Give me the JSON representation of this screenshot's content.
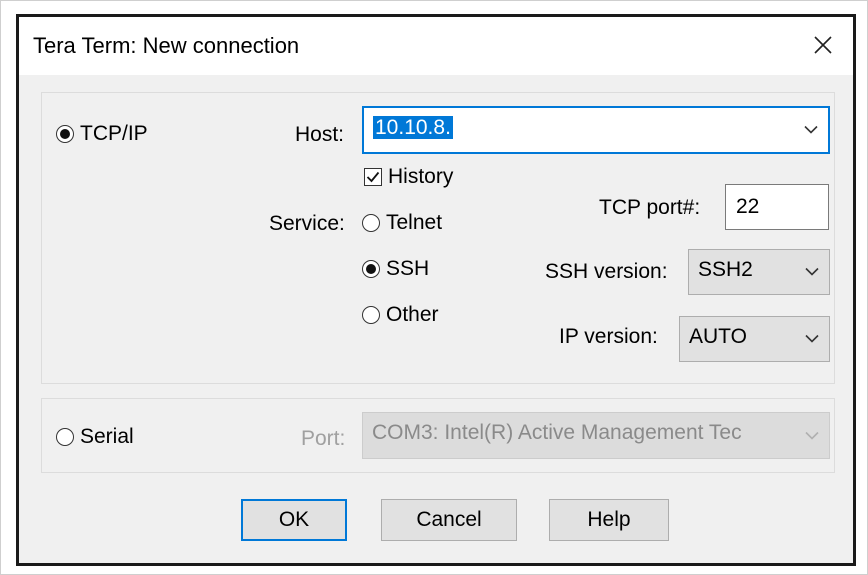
{
  "window": {
    "title": "Tera Term: New connection"
  },
  "tcpip": {
    "radio_label": "TCP/IP",
    "selected": true,
    "host_label": "Host:",
    "host_value": "10.10.8.",
    "history_label": "History",
    "history_checked": true,
    "service_label": "Service:",
    "services": [
      {
        "label": "Telnet",
        "selected": false
      },
      {
        "label": "SSH",
        "selected": true
      },
      {
        "label": "Other",
        "selected": false
      }
    ],
    "tcp_port_label": "TCP port#:",
    "tcp_port_value": "22",
    "ssh_version_label": "SSH version:",
    "ssh_version_value": "SSH2",
    "ip_version_label": "IP version:",
    "ip_version_value": "AUTO"
  },
  "serial": {
    "radio_label": "Serial",
    "selected": false,
    "port_label": "Port:",
    "port_value": "COM3: Intel(R) Active Management Tec"
  },
  "buttons": {
    "ok": "OK",
    "cancel": "Cancel",
    "help": "Help"
  },
  "icons": {
    "close": "close-icon",
    "dropdown": "chevron-down-icon",
    "check": "check-icon"
  },
  "colors": {
    "accent": "#0078d7",
    "dialog_bg": "#f0f0f0",
    "disabled_text": "#a0a0a0"
  }
}
